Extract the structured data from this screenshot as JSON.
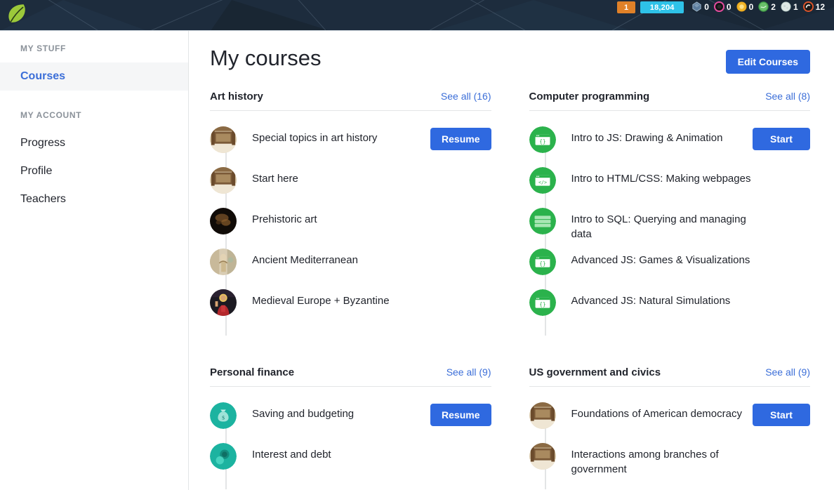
{
  "topbar": {
    "logo_icon": "khan-academy-leaf-logo",
    "energy_points_pill": "1",
    "points_pill": "18,204",
    "badges": [
      {
        "icon": "sapphire-badge-icon",
        "count": "0"
      },
      {
        "icon": "challenge-patch-badge-icon",
        "count": "0"
      },
      {
        "icon": "sun-badge-icon",
        "count": "0"
      },
      {
        "icon": "earth-badge-icon",
        "count": "2"
      },
      {
        "icon": "moon-badge-icon",
        "count": "1"
      },
      {
        "icon": "meteorite-badge-icon",
        "count": "12"
      }
    ]
  },
  "sidebar": {
    "groups": [
      {
        "label": "MY STUFF",
        "items": [
          {
            "label": "Courses",
            "active": true
          }
        ]
      },
      {
        "label": "MY ACCOUNT",
        "items": [
          {
            "label": "Progress",
            "active": false
          },
          {
            "label": "Profile",
            "active": false
          },
          {
            "label": "Teachers",
            "active": false
          }
        ]
      }
    ]
  },
  "main": {
    "title": "My courses",
    "edit_button": "Edit Courses",
    "sections": [
      {
        "title": "Art history",
        "see_all": "See all (16)",
        "action_button": "Resume",
        "courses": [
          {
            "label": "Special topics in art history",
            "icon": "art-history-interior-thumbnail"
          },
          {
            "label": "Start here",
            "icon": "art-history-interior-thumbnail"
          },
          {
            "label": "Prehistoric art",
            "icon": "prehistoric-art-thumbnail"
          },
          {
            "label": "Ancient Mediterranean",
            "icon": "ancient-mediterranean-thumbnail"
          },
          {
            "label": "Medieval Europe + Byzantine",
            "icon": "medieval-europe-thumbnail"
          }
        ]
      },
      {
        "title": "Computer programming",
        "see_all": "See all (8)",
        "action_button": "Start",
        "courses": [
          {
            "label": "Intro to JS: Drawing & Animation",
            "icon": "js-code-window-icon"
          },
          {
            "label": "Intro to HTML/CSS: Making webpages",
            "icon": "html-css-window-icon"
          },
          {
            "label": "Intro to SQL: Querying and managing data",
            "icon": "sql-database-icon"
          },
          {
            "label": "Advanced JS: Games & Visualizations",
            "icon": "js-code-window-icon"
          },
          {
            "label": "Advanced JS: Natural Simulations",
            "icon": "js-code-window-icon"
          }
        ]
      },
      {
        "title": "Personal finance",
        "see_all": "See all (9)",
        "action_button": "Resume",
        "courses": [
          {
            "label": "Saving and budgeting",
            "icon": "money-bag-icon"
          },
          {
            "label": "Interest and debt",
            "icon": "coins-icon"
          }
        ]
      },
      {
        "title": "US government and civics",
        "see_all": "See all (9)",
        "action_button": "Start",
        "courses": [
          {
            "label": "Foundations of American democracy",
            "icon": "capitol-interior-thumbnail"
          },
          {
            "label": "Interactions among branches of government",
            "icon": "capitol-interior-thumbnail"
          }
        ]
      }
    ]
  },
  "colors": {
    "accent_blue": "#2f69e0",
    "link_blue": "#3b6ed8",
    "topbar_navy": "#1d2c3d",
    "cs_green": "#28a745",
    "finance_teal": "#1cb3a0",
    "energy_orange": "#e08128",
    "points_cyan": "#2ec2e8"
  }
}
